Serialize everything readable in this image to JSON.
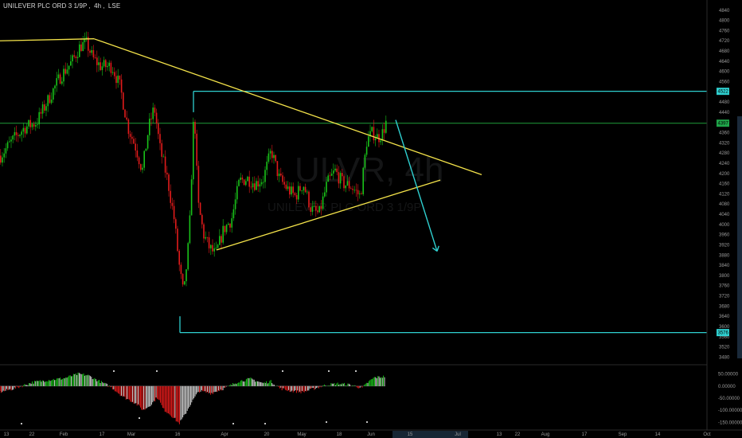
{
  "header": {
    "symbol_name": "UNILEVER PLC ORD 3 1/9P",
    "interval": "4h",
    "exchange": "LSE"
  },
  "watermark": {
    "ticker_large": "ULVR, 4h",
    "subtitle": "UNILEVER PLC ORD 3 1/9P"
  },
  "colors": {
    "background": "#000000",
    "up": "#19c219",
    "down": "#e21b1b",
    "trendline": "#f4e34a",
    "level": "#2fd0d0",
    "signal_arrow": "#2fd0d0",
    "price_line": "#1f9e3a",
    "price_badge": "#1fa64a",
    "axis_text": "#9b9b9b"
  },
  "chart_data": {
    "type": "candlestick",
    "ylim": [
      3450,
      4880
    ],
    "y_ticks": [
      4840,
      4800,
      4760,
      4720,
      4680,
      4640,
      4600,
      4560,
      4520,
      4480,
      4440,
      4400,
      4360,
      4320,
      4280,
      4240,
      4200,
      4160,
      4120,
      4080,
      4040,
      4000,
      3960,
      3920,
      3880,
      3840,
      3800,
      3760,
      3720,
      3680,
      3640,
      3600,
      3560,
      3520,
      3480
    ],
    "x_axis_labels": [
      "13",
      "22",
      "Feb",
      "17",
      "Mar",
      "16",
      "Apr",
      "20",
      "May",
      "18",
      "Jun",
      "15",
      "Jul",
      "13",
      "22",
      "Aug",
      "17",
      "Sep",
      "14",
      "Oct"
    ],
    "levels": [
      {
        "name": "resistance",
        "value": 4522,
        "badge": "4522"
      },
      {
        "name": "support",
        "value": 3576,
        "badge": "3576"
      }
    ],
    "last_price": {
      "value": 4397,
      "badge": "4397"
    },
    "candle_path": [
      [
        0,
        4270
      ],
      [
        15,
        4330
      ],
      [
        30,
        4380
      ],
      [
        45,
        4400
      ],
      [
        60,
        4490
      ],
      [
        75,
        4580
      ],
      [
        90,
        4640
      ],
      [
        100,
        4700
      ],
      [
        108,
        4710
      ],
      [
        116,
        4650
      ],
      [
        126,
        4620
      ],
      [
        140,
        4620
      ],
      [
        150,
        4540
      ],
      [
        160,
        4380
      ],
      [
        170,
        4300
      ],
      [
        178,
        4210
      ],
      [
        186,
        4380
      ],
      [
        193,
        4460
      ],
      [
        200,
        4300
      ],
      [
        210,
        4170
      ],
      [
        218,
        4020
      ],
      [
        225,
        3820
      ],
      [
        230,
        3720
      ],
      [
        237,
        3960
      ],
      [
        243,
        4470
      ],
      [
        248,
        4080
      ],
      [
        255,
        3960
      ],
      [
        262,
        3910
      ],
      [
        270,
        3880
      ],
      [
        280,
        3980
      ],
      [
        290,
        4020
      ],
      [
        300,
        4170
      ],
      [
        310,
        4180
      ],
      [
        320,
        4160
      ],
      [
        330,
        4180
      ],
      [
        340,
        4290
      ],
      [
        350,
        4180
      ],
      [
        360,
        4140
      ],
      [
        370,
        4110
      ],
      [
        380,
        4160
      ],
      [
        390,
        4060
      ],
      [
        400,
        4040
      ],
      [
        410,
        4160
      ],
      [
        420,
        4210
      ],
      [
        430,
        4160
      ],
      [
        440,
        4150
      ],
      [
        452,
        4110
      ],
      [
        460,
        4330
      ],
      [
        467,
        4360
      ],
      [
        474,
        4340
      ],
      [
        480,
        4360
      ],
      [
        484,
        4400
      ]
    ],
    "trendlines": [
      {
        "name": "pivot-line",
        "from": [
          0,
          4720
        ],
        "to": [
          118,
          4728
        ]
      },
      {
        "name": "descending-resistance",
        "from": [
          118,
          4728
        ],
        "to": [
          605,
          4195
        ]
      },
      {
        "name": "ascending-support",
        "from": [
          272,
          3900
        ],
        "to": [
          553,
          4174
        ]
      }
    ],
    "projection_arrow": {
      "from": [
        497,
        4410
      ],
      "to": [
        549,
        3895
      ]
    },
    "oscillator": {
      "ylim": [
        -165,
        75
      ],
      "y_ticks": [
        {
          "label": "50.00000",
          "value": 50
        },
        {
          "label": "0.00000",
          "value": 0
        },
        {
          "label": "-50.00000",
          "value": -50
        },
        {
          "label": "-100.00000",
          "value": -100
        },
        {
          "label": "-150.00000",
          "value": -150
        }
      ],
      "path": [
        [
          0,
          -25
        ],
        [
          20,
          -8
        ],
        [
          40,
          15
        ],
        [
          60,
          25
        ],
        [
          80,
          32
        ],
        [
          98,
          50
        ],
        [
          110,
          45
        ],
        [
          125,
          20
        ],
        [
          140,
          -5
        ],
        [
          155,
          -45
        ],
        [
          170,
          -70
        ],
        [
          180,
          -100
        ],
        [
          190,
          -75
        ],
        [
          198,
          -45
        ],
        [
          205,
          -95
        ],
        [
          215,
          -120
        ],
        [
          225,
          -155
        ],
        [
          233,
          -115
        ],
        [
          240,
          -70
        ],
        [
          250,
          -20
        ],
        [
          265,
          -30
        ],
        [
          285,
          -5
        ],
        [
          300,
          20
        ],
        [
          315,
          30
        ],
        [
          330,
          12
        ],
        [
          340,
          20
        ],
        [
          352,
          -10
        ],
        [
          365,
          -20
        ],
        [
          380,
          -25
        ],
        [
          395,
          -10
        ],
        [
          410,
          5
        ],
        [
          425,
          10
        ],
        [
          440,
          5
        ],
        [
          455,
          -8
        ],
        [
          462,
          15
        ],
        [
          470,
          35
        ],
        [
          484,
          40
        ]
      ]
    }
  }
}
